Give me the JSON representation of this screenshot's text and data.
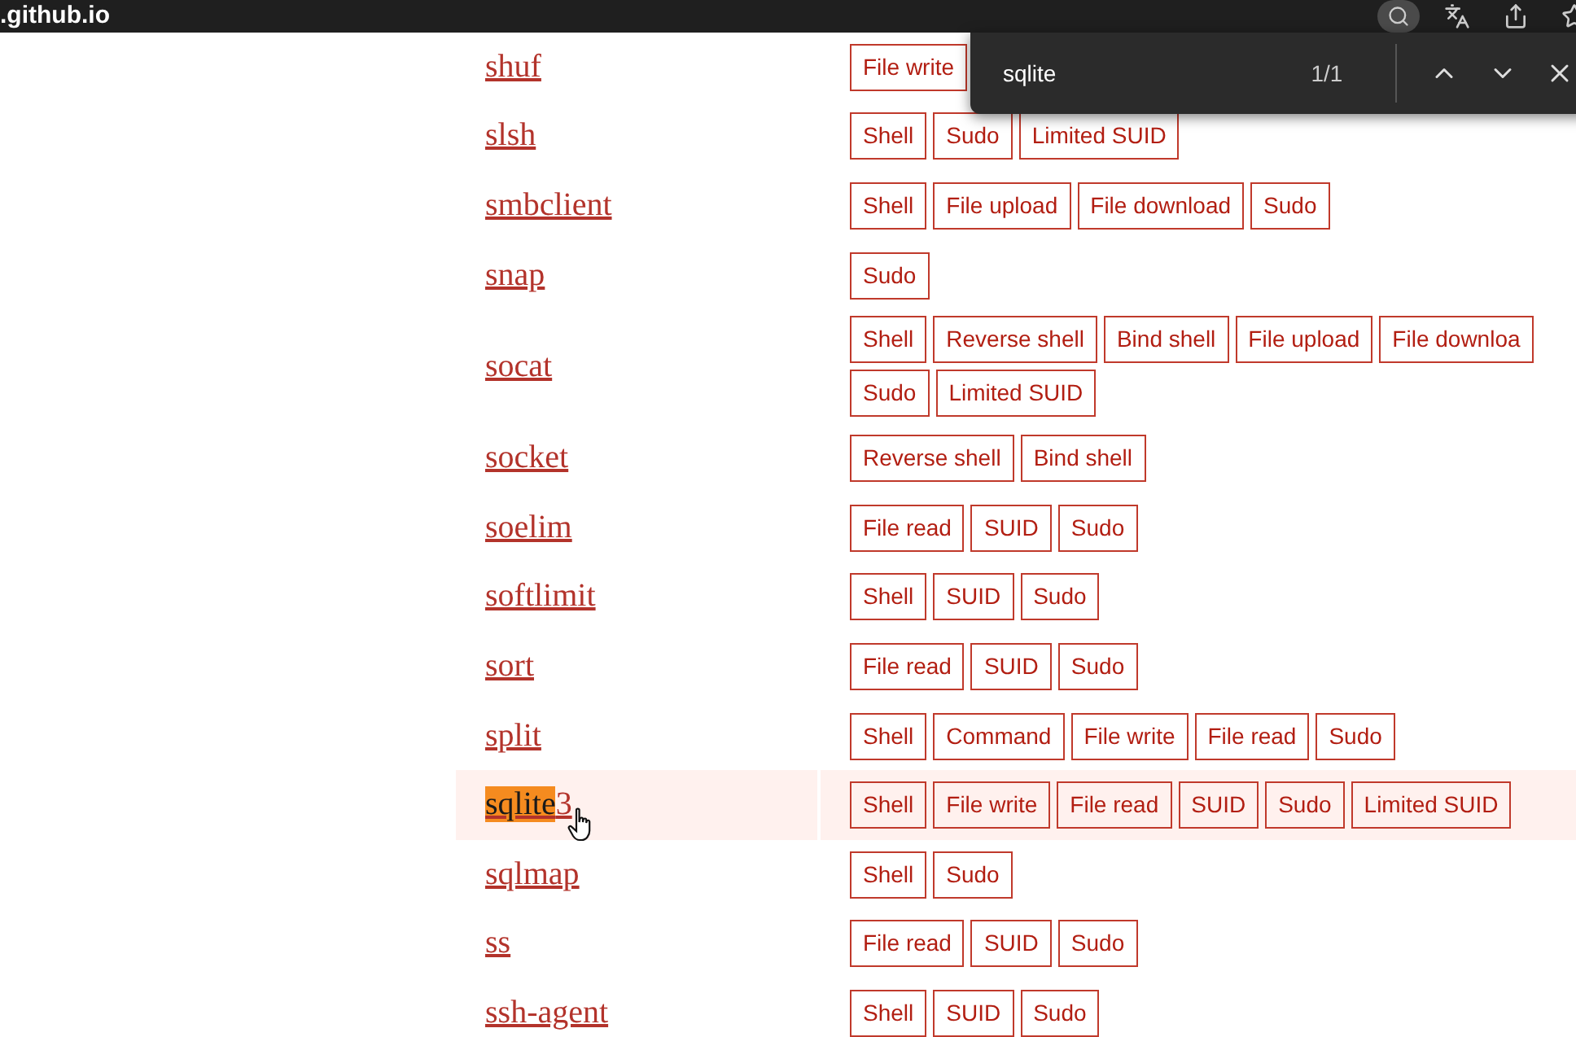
{
  "address_bar": {
    "text": ".github.io"
  },
  "find_bar": {
    "query": "sqlite",
    "count": "1/1"
  },
  "rows": [
    {
      "name": [
        {
          "text": "shuf",
          "found": false
        }
      ],
      "selected": false,
      "tags": [
        "File write"
      ]
    },
    {
      "name": [
        {
          "text": "slsh",
          "found": false
        }
      ],
      "selected": false,
      "tags": [
        "Shell",
        "Sudo",
        "Limited SUID"
      ]
    },
    {
      "name": [
        {
          "text": "smbclient",
          "found": false
        }
      ],
      "selected": false,
      "tags": [
        "Shell",
        "File upload",
        "File download",
        "Sudo"
      ]
    },
    {
      "name": [
        {
          "text": "snap",
          "found": false
        }
      ],
      "selected": false,
      "tags": [
        "Sudo"
      ]
    },
    {
      "name": [
        {
          "text": "socat",
          "found": false
        }
      ],
      "selected": false,
      "tags": [
        "Shell",
        "Reverse shell",
        "Bind shell",
        "File upload",
        "File downloa",
        "Sudo",
        "Limited SUID"
      ]
    },
    {
      "name": [
        {
          "text": "socket",
          "found": false
        }
      ],
      "selected": false,
      "tags": [
        "Reverse shell",
        "Bind shell"
      ]
    },
    {
      "name": [
        {
          "text": "soelim",
          "found": false
        }
      ],
      "selected": false,
      "tags": [
        "File read",
        "SUID",
        "Sudo"
      ]
    },
    {
      "name": [
        {
          "text": "softlimit",
          "found": false
        }
      ],
      "selected": false,
      "tags": [
        "Shell",
        "SUID",
        "Sudo"
      ]
    },
    {
      "name": [
        {
          "text": "sort",
          "found": false
        }
      ],
      "selected": false,
      "tags": [
        "File read",
        "SUID",
        "Sudo"
      ]
    },
    {
      "name": [
        {
          "text": "split",
          "found": false
        }
      ],
      "selected": false,
      "tags": [
        "Shell",
        "Command",
        "File write",
        "File read",
        "Sudo"
      ]
    },
    {
      "name": [
        {
          "text": "sqlite",
          "found": true
        },
        {
          "text": "3",
          "found": false
        }
      ],
      "selected": true,
      "tags": [
        "Shell",
        "File write",
        "File read",
        "SUID",
        "Sudo",
        "Limited SUID"
      ]
    },
    {
      "name": [
        {
          "text": "sqlmap",
          "found": false
        }
      ],
      "selected": false,
      "tags": [
        "Shell",
        "Sudo"
      ]
    },
    {
      "name": [
        {
          "text": "ss",
          "found": false
        }
      ],
      "selected": false,
      "tags": [
        "File read",
        "SUID",
        "Sudo"
      ]
    },
    {
      "name": [
        {
          "text": "ssh-agent",
          "found": false
        }
      ],
      "selected": false,
      "tags": [
        "Shell",
        "SUID",
        "Sudo"
      ]
    }
  ]
}
